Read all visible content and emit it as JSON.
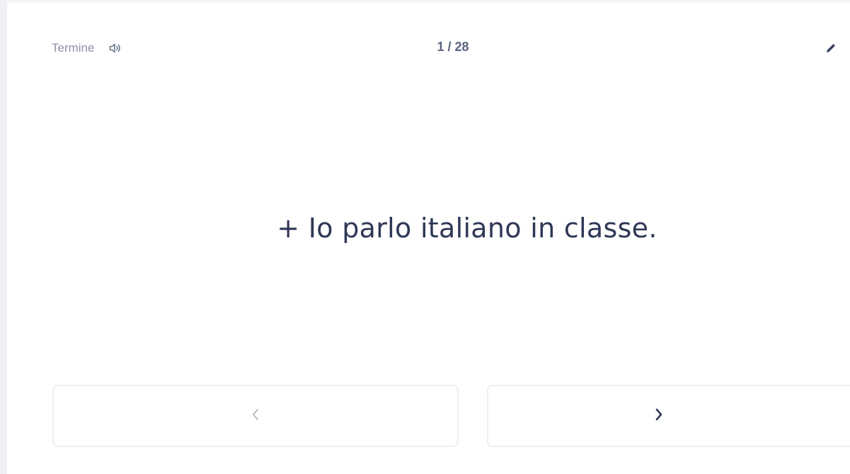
{
  "header": {
    "side_label": "Termine",
    "counter_current": "1",
    "counter_separator": " / ",
    "counter_total": "28"
  },
  "card": {
    "text": "+ Io parlo italiano in classe."
  },
  "icons": {
    "audio": "speaker-icon",
    "edit": "pencil-icon",
    "previous": "chevron-left-icon",
    "next": "chevron-right-icon"
  },
  "colors": {
    "label": "#8c93a8",
    "counter": "#586380",
    "term_text": "#2e3856",
    "button_border": "#edeff4",
    "prev_arrow_disabled": "#b4b9c6",
    "next_arrow": "#2e3856"
  }
}
